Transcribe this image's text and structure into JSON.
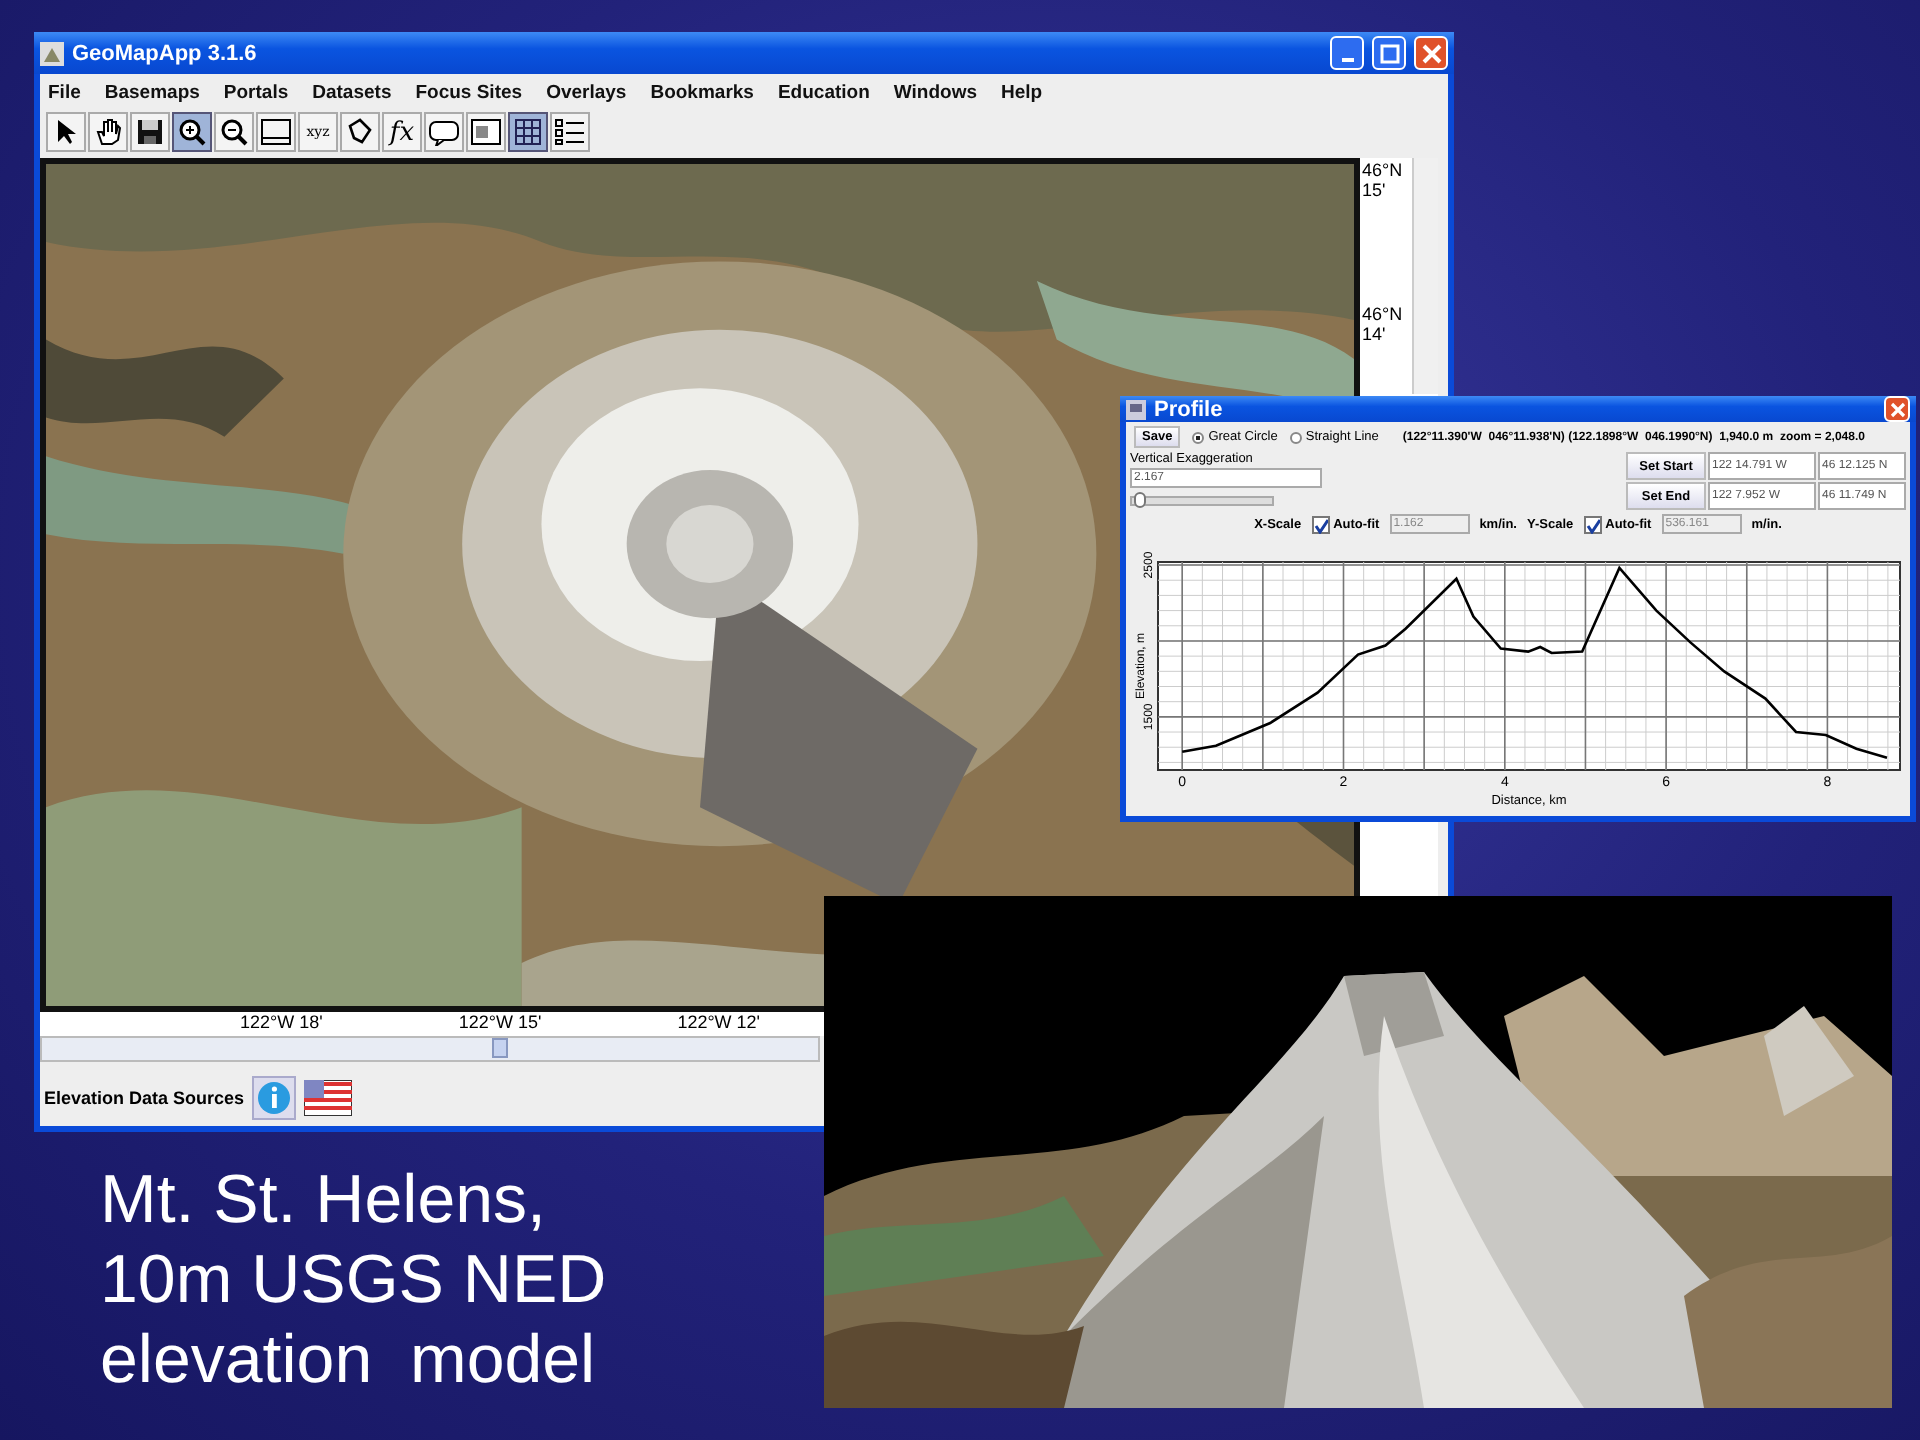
{
  "main_window": {
    "title": "GeoMapApp 3.1.6",
    "menu": [
      "File",
      "Basemaps",
      "Portals",
      "Datasets",
      "Focus Sites",
      "Overlays",
      "Bookmarks",
      "Education",
      "Windows",
      "Help"
    ],
    "toolbar": [
      {
        "kind": "pointer",
        "selected": false
      },
      {
        "kind": "hand",
        "selected": false
      },
      {
        "kind": "save",
        "selected": false
      },
      {
        "kind": "zoom-in",
        "selected": true
      },
      {
        "kind": "zoom-out",
        "selected": false
      },
      {
        "kind": "frame",
        "selected": false
      },
      {
        "kind": "axes",
        "glyph": "xyz",
        "selected": false
      },
      {
        "kind": "lasso",
        "selected": false
      },
      {
        "kind": "function",
        "glyph": "fx",
        "selected": false
      },
      {
        "kind": "bubble",
        "selected": false
      },
      {
        "kind": "window",
        "selected": false
      },
      {
        "kind": "grid",
        "selected": true
      },
      {
        "kind": "list",
        "selected": false
      }
    ],
    "lat_labels": [
      "46°N\n15'",
      "46°N\n14'"
    ],
    "lon_labels": [
      "122°W 18'",
      "122°W 15'",
      "122°W 12'"
    ],
    "status": {
      "label": "Elevation Data Sources"
    }
  },
  "profile_window": {
    "title": "Profile",
    "save": "Save",
    "options": [
      {
        "label": "Great Circle",
        "selected": true
      },
      {
        "label": "Straight Line",
        "selected": false
      }
    ],
    "readout": "(122°11.390'W  046°11.938'N) (122.1898°W  046.1990°N)  1,940.0 m  zoom = 2,048.0",
    "vertical_exaggeration": {
      "label": "Vertical Exaggeration",
      "value": "2.167",
      "level": 0.02
    },
    "set_start": {
      "label": "Set Start",
      "lon": "122 14.791 W",
      "lat": "46 12.125 N"
    },
    "set_end": {
      "label": "Set End",
      "lon": "122 7.952 W",
      "lat": "46 11.749 N"
    },
    "x_scale": {
      "label": "X-Scale",
      "auto_fit": "Auto-fit",
      "checked": true,
      "value": "1.162",
      "unit": "km/in."
    },
    "y_scale": {
      "label": "Y-Scale",
      "auto_fit": "Auto-fit",
      "checked": true,
      "value": "536.161",
      "unit": "m/in."
    },
    "chart_data": {
      "type": "line",
      "grid": true,
      "xlabel": "Distance, km",
      "ylabel": "Elevation, m",
      "xlim": [
        -0.3,
        8.9
      ],
      "ylim": [
        1150,
        2520
      ],
      "xticks": [
        0,
        2,
        4,
        6,
        8
      ],
      "yticks": [
        1500,
        2500
      ],
      "x": [
        0,
        0.42,
        1.09,
        1.68,
        2.18,
        2.52,
        2.77,
        3.4,
        3.61,
        3.95,
        4.29,
        4.44,
        4.58,
        4.96,
        5.42,
        5.88,
        6.3,
        6.72,
        7.23,
        7.61,
        7.98,
        8.36,
        8.74
      ],
      "series": [
        {
          "color": "#000000",
          "values": [
            1270,
            1310,
            1460,
            1660,
            1910,
            1970,
            2080,
            2410,
            2160,
            1950,
            1930,
            1960,
            1920,
            1930,
            2480,
            2200,
            1990,
            1800,
            1620,
            1400,
            1380,
            1290,
            1230
          ]
        }
      ]
    }
  },
  "caption": "Mt. St. Helens,\n10m USGS NED\nelevation  model"
}
